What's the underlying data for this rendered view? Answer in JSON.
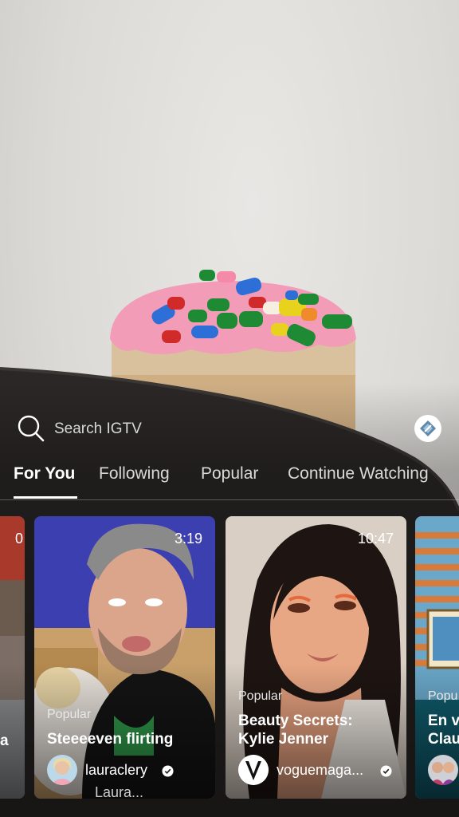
{
  "search": {
    "placeholder": "Search IGTV"
  },
  "tabs": [
    {
      "label": "For You",
      "active": true
    },
    {
      "label": "Following",
      "active": false
    },
    {
      "label": "Popular",
      "active": false
    },
    {
      "label": "Continue Watching",
      "active": false
    }
  ],
  "cards": [
    {
      "duration": "0",
      "tag": "",
      "title": "a",
      "user": ""
    },
    {
      "duration": "3:19",
      "tag": "Popular",
      "title": "Steeeeven flirting",
      "user": "lauraclery",
      "verified": true,
      "sub": "Laura..."
    },
    {
      "duration": "10:47",
      "tag": "Popular",
      "title_line1": "Beauty Secrets:",
      "title_line2": "Kylie Jenner",
      "user": "voguemaga...",
      "verified": true
    },
    {
      "tag": "Popu",
      "title_line1": "En v",
      "title_line2": "Clau"
    }
  ],
  "icons": {
    "search": "search-icon",
    "profile": "igtv-profile-icon",
    "verified": "verified-badge-icon"
  },
  "colors": {
    "accent": "#ffffff",
    "tab_inactive": "#d9d9d9"
  }
}
